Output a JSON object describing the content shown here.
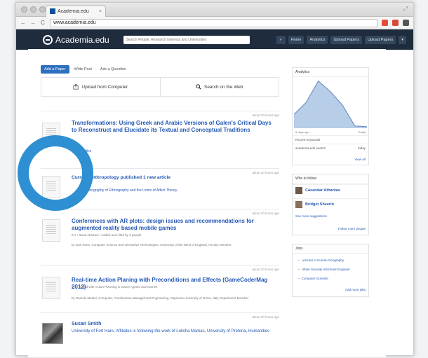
{
  "browser": {
    "tab_title": "Academia.edu",
    "tab_close": "×",
    "address": "www.academia.edu",
    "nav": {
      "back": "←",
      "forward": "→",
      "reload": "C"
    },
    "extension_colors": [
      "#e34b3b",
      "#d84a38",
      "#555555"
    ]
  },
  "header": {
    "logo_text": "Academia.edu",
    "search_placeholder": "Search People, Research Interests and Universities",
    "nav": [
      "Home",
      "Analytics",
      "Upload Papers",
      "Upload Papers"
    ],
    "more_icon": "▾",
    "bg_color": "#1e2c3d"
  },
  "share": {
    "tabs": [
      "Add a Paper",
      "Write Post",
      "Ask a Question"
    ],
    "upload_label": "Upload from Computer",
    "search_web_label": "Search on the Web"
  },
  "feed": [
    {
      "time": "about 20 hours ago",
      "title": "Transformations: Using Greek and Arabic Versions of Galen's Critical Days to Reconstruct and Elucidate its Textual and Conceptual Traditions",
      "meta": "0.1",
      "link": "0.1 Analytics"
    },
    {
      "time": "about 20 hours ago",
      "title": "Current Anthropology published 1 new article",
      "link": "The Ethnography of Ethnography and the Limits of Affect Theory"
    },
    {
      "time": "about 20 hours ago",
      "title": "Conferences with AR plots: design issues and recommendations for augmented reality based mobile games",
      "meta": "0.1 • Read Abstract • Added and cited by 2 people",
      "authors": "by Dan Rees, Computer Science and Interactive Technologies, University of the West of England, Faculty Member"
    },
    {
      "time": "about 20 hours ago",
      "title": "Real-time Action Planing with Preconditions and Effects (GameCoderMag 2012)",
      "meta": "0.1 • Added with Action Planning in Game Agents and Games",
      "authors": "by Daniele Melani, Computer, Construction Management Engineering, Sapienza University of Rome, Italy Department Member"
    }
  ],
  "person": {
    "time": "about 20 hours ago",
    "name": "Susan Smith",
    "desc": "University of Fort Hare, Affiliates is following the work of Lolisha Mamas, University of Pretoria, Humanities"
  },
  "sidebar": {
    "analytics_title": "Analytics",
    "analytics_points": [
      18,
      34,
      62,
      48,
      30,
      3,
      2
    ],
    "analytics_labels": [
      "6 days ago",
      "Today"
    ],
    "recent_title": "Recent Keywords",
    "recent_row": {
      "label": "academia.edu search",
      "value": "today"
    },
    "see_all": "View All",
    "follow_title": "Who to follow",
    "follow": [
      "Cásandar Athantas",
      "Bridget Sheerin"
    ],
    "follow_more": "See more suggestions",
    "follow_footer": "Follow more people",
    "jobs_title": "Jobs",
    "jobs": [
      "Lecturer in Human Geography",
      "Urban Security Informant Engineer",
      "Computer Scientist"
    ],
    "jobs_more": "Add more jobs"
  },
  "overlay": {
    "color": "#2e8fd2"
  }
}
